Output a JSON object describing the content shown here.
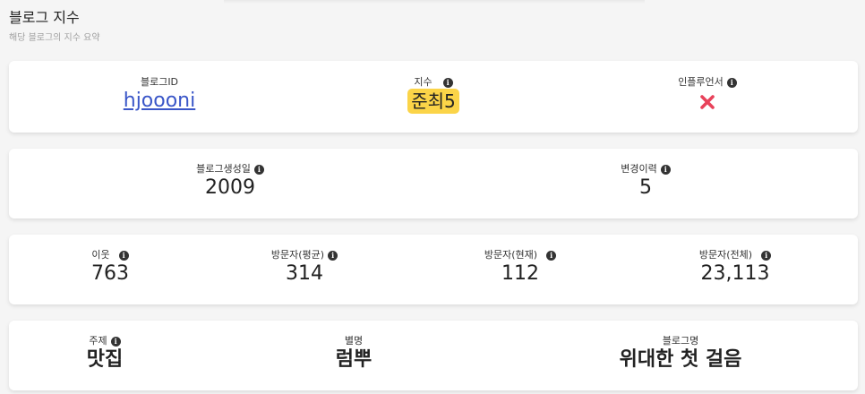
{
  "section": {
    "title": "블로그 지수",
    "subtitle": "해당 블로그의 지수 요약"
  },
  "summary": {
    "blog_id_label": "블로그ID",
    "blog_id_value": "hjoooni",
    "index_label": "지수",
    "index_value": "준최5",
    "influencer_label": "인플루언서",
    "influencer_status_icon": "x-icon"
  },
  "history": {
    "created_label": "블로그생성일",
    "created_value": "2009",
    "changes_label": "변경이력",
    "changes_value": "5"
  },
  "stats": {
    "neighbors_label": "이웃",
    "neighbors_value": "763",
    "visitors_avg_label": "방문자(평균)",
    "visitors_avg_value": "314",
    "visitors_now_label": "방문자(현재)",
    "visitors_now_value": "112",
    "visitors_total_label": "방문자(전체)",
    "visitors_total_value": "23,113"
  },
  "profile": {
    "topic_label": "주제",
    "topic_value": "맛집",
    "nickname_label": "별명",
    "nickname_value": "럼뿌",
    "blog_name_label": "블로그명",
    "blog_name_value": "위대한 첫 걸음"
  },
  "colors": {
    "badge_bg": "#fbd448",
    "link": "#3a56c8",
    "negative": "#e8425a"
  }
}
